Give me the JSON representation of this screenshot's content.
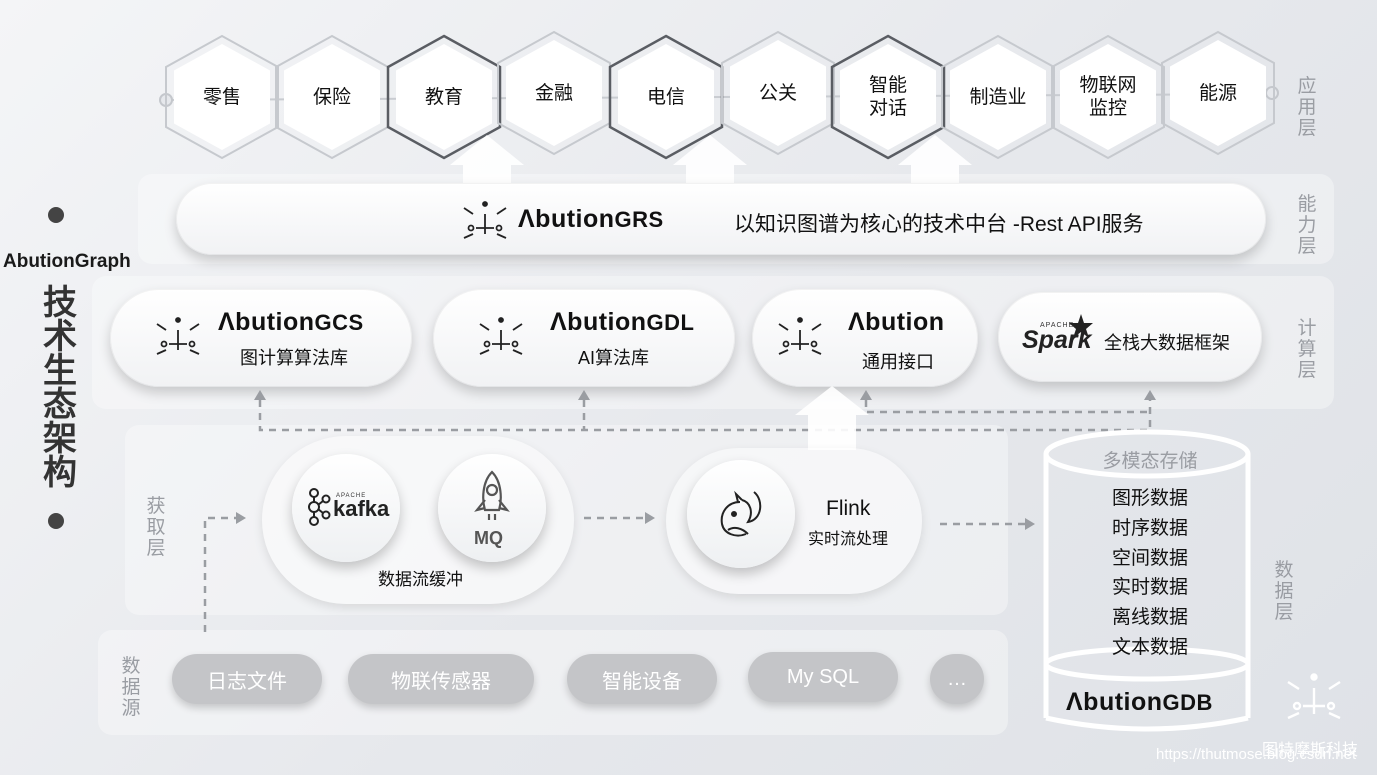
{
  "side_title": "AbutionGraph",
  "vertical_title": "技术生态架构",
  "layers": {
    "app": "应用层",
    "ability": "能力层",
    "compute": "计算层",
    "acquire": "获取层",
    "source": "数据源",
    "data": "数据层"
  },
  "apps": [
    "零售",
    "保险",
    "教育",
    "金融",
    "电信",
    "公关",
    "智能\n对话",
    "制造业",
    "物联网\n监控",
    "能源"
  ],
  "grs": {
    "brand": "Λbution",
    "suffix": "GRS",
    "desc": "以知识图谱为核心的技术中台 -Rest API服务"
  },
  "compute": {
    "gcs": {
      "brand": "Λbution",
      "suffix": "GCS",
      "sub": "图计算算法库"
    },
    "gdl": {
      "brand": "Λbution",
      "suffix": "GDL",
      "sub": "AI算法库"
    },
    "api": {
      "brand": "Λbution",
      "sub": "通用接口"
    },
    "spark": {
      "logo": "Spark",
      "apache": "APACHE",
      "sub": "全栈大数据框架"
    }
  },
  "acquire": {
    "kafka": {
      "logo": "kafka",
      "apache": "APACHE"
    },
    "mq": "MQ",
    "buffer_label": "数据流缓冲",
    "flink": {
      "title": "Flink",
      "sub": "实时流处理"
    }
  },
  "sources": [
    "日志文件",
    "物联传感器",
    "智能设备",
    "My SQL",
    "…"
  ],
  "storage": {
    "title": "多模态存储",
    "items": [
      "图形数据",
      "时序数据",
      "空间数据",
      "实时数据",
      "离线数据",
      "文本数据"
    ],
    "brand": "Λbution",
    "suffix": "GDB"
  },
  "company": "图特摩斯科技",
  "watermark": "https://thutmose.blog.csdn.net"
}
